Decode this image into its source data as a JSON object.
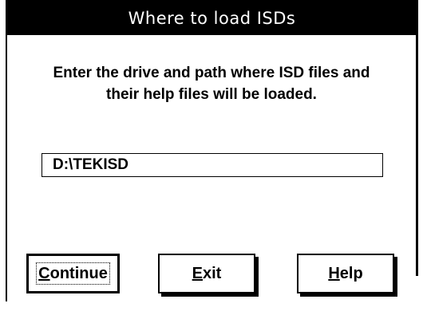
{
  "window": {
    "title": "Where to load ISDs"
  },
  "prompt": {
    "line1": "Enter the drive and path where ISD files and",
    "line2": "their help files will be loaded."
  },
  "path_field": {
    "value": "D:\\TEKISD"
  },
  "buttons": {
    "continue": {
      "mnemonic": "C",
      "rest": "ontinue",
      "focused": true
    },
    "exit": {
      "mnemonic": "E",
      "rest": "xit"
    },
    "help": {
      "mnemonic": "H",
      "rest": "elp"
    }
  },
  "colors": {
    "title_bar_background": "#000000",
    "title_text": "#ffffff",
    "dialog_background": "#ffffff"
  }
}
